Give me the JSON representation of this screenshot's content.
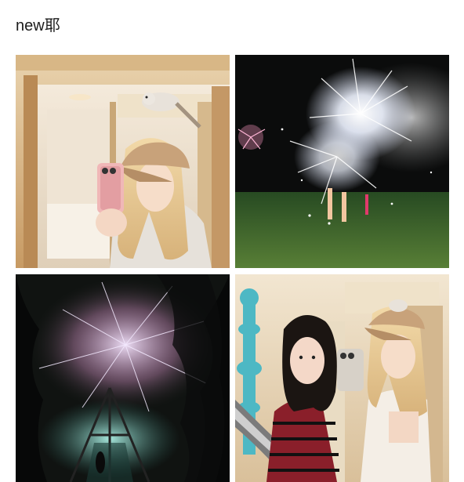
{
  "post": {
    "text": "new耶",
    "top_partial_text": "•••• •••"
  },
  "images": [
    {
      "subject": "mirror-selfie-with-bird",
      "accent": "#c8a27a"
    },
    {
      "subject": "fireworks-on-lawn",
      "accent": "#1e3f1c"
    },
    {
      "subject": "fireworks-through-trees",
      "accent": "#0f1210"
    },
    {
      "subject": "two-friends-mirror-selfie",
      "accent": "#c8a27a"
    }
  ]
}
